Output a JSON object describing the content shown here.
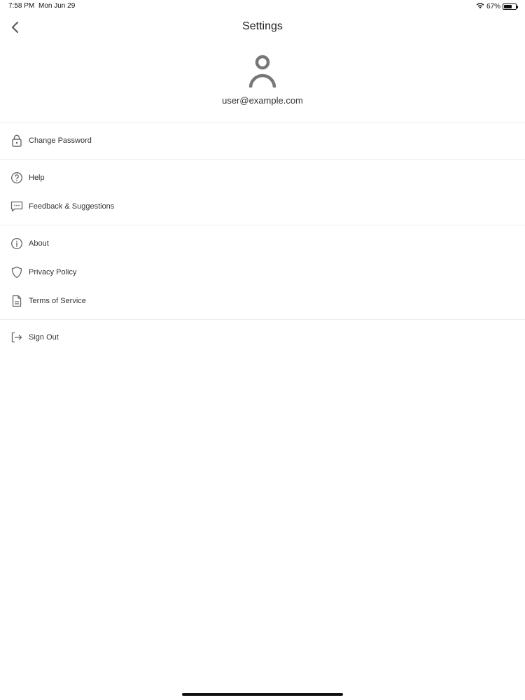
{
  "status_bar": {
    "time": "7:58 PM",
    "date": "Mon Jun 29",
    "battery_percent": "67%",
    "battery_level": 0.67,
    "wifi_icon": "wifi-icon"
  },
  "nav": {
    "title": "Settings",
    "back_icon": "chevron-left-icon"
  },
  "profile": {
    "avatar_icon": "person-icon",
    "email": "user@example.com"
  },
  "menu": {
    "change_password": {
      "label": "Change Password",
      "icon": "lock-icon"
    },
    "help": {
      "label": "Help",
      "icon": "question-circle-icon"
    },
    "feedback": {
      "label": "Feedback & Suggestions",
      "icon": "chat-bubble-icon"
    },
    "about": {
      "label": "About",
      "icon": "info-circle-icon"
    },
    "privacy": {
      "label": "Privacy Policy",
      "icon": "shield-icon"
    },
    "terms": {
      "label": "Terms of Service",
      "icon": "document-icon"
    },
    "sign_out": {
      "label": "Sign Out",
      "icon": "sign-out-icon"
    }
  },
  "colors": {
    "icon": "#666666",
    "text": "#333333",
    "divider": "#ececec",
    "background": "#ffffff"
  }
}
